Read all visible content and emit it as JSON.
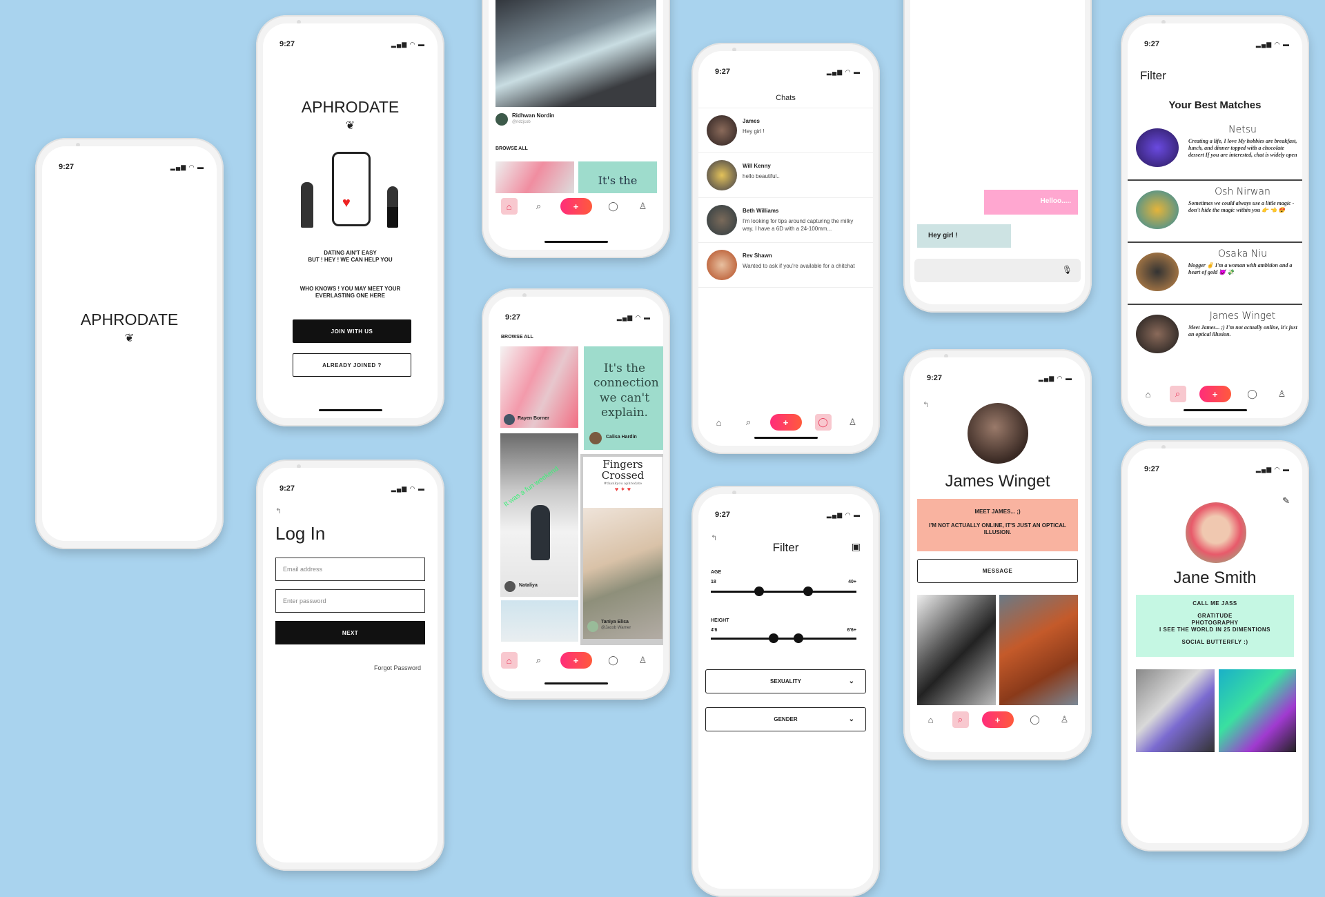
{
  "status": {
    "time": "9:27",
    "icons": "signal-wifi-battery"
  },
  "brand": {
    "name": "APHRODATE",
    "logo": "rose-icon"
  },
  "landing": {
    "line1": "DATING AIN'T EASY",
    "line2": "BUT ! HEY ! WE CAN HELP YOU",
    "line3": "WHO KNOWS ! YOU MAY MEET YOUR",
    "line4": "EVERLASTING ONE HERE",
    "join": "JOIN WITH US",
    "already": "ALREADY JOINED ?"
  },
  "login": {
    "title": "Log In",
    "email_placeholder": "Email address",
    "password_placeholder": "Enter password",
    "next": "NEXT",
    "forgot": "Forgot Password"
  },
  "feed": {
    "author": "Ridhwan Nordin",
    "handle": "@ridzjcob",
    "browse": "BROWSE ALL",
    "teaser": "It's the"
  },
  "browse": {
    "title": "BROWSE ALL",
    "posts": [
      {
        "author": "Rayen Borner"
      },
      {
        "quote": "It's the connection we can't explain.",
        "author": "Calisa Hardin"
      },
      {
        "overlay": "It was a fun weekend",
        "author": "Nataliya"
      },
      {
        "title": "Fingers Crossed",
        "tag": "#thankyou aphrodate",
        "author": "Taniya Elisa",
        "handle": "@Jacob Warner"
      }
    ]
  },
  "chats": {
    "title": "Chats",
    "items": [
      {
        "name": "James",
        "msg": "Hey girl !"
      },
      {
        "name": "Will Kenny",
        "msg": "hello beautiful.."
      },
      {
        "name": "Beth Williams",
        "msg": "I'm looking for tips around capturing the milky way. I have a 6D with a 24-100mm..."
      },
      {
        "name": "Rev Shawn",
        "msg": "Wanted to ask if you're available for a chitchat"
      }
    ]
  },
  "messages": {
    "sent": "Helloo.....",
    "received": "Hey girl !",
    "input_placeholder": ""
  },
  "filter": {
    "title": "Filter",
    "age_label": "AGE",
    "age_min": "18",
    "age_max": "40+",
    "age_range": [
      0.33,
      0.67
    ],
    "height_label": "HEIGHT",
    "height_min": "4'6",
    "height_max": "6'6+",
    "height_range": [
      0.43,
      0.6
    ],
    "sexuality": "SEXUALITY",
    "gender": "GENDER"
  },
  "profile_james": {
    "name": "James Winget",
    "bio1": "MEET JAMES...     ;)",
    "bio2": "I'M NOT ACTUALLY ONLINE, IT'S JUST AN OPTICAL ILLUSION.",
    "message": "MESSAGE"
  },
  "matches": {
    "filter": "Filter",
    "title": "Your Best Matches",
    "items": [
      {
        "name": "Netsu",
        "bio": "Creating a life, I love My hobbies are breakfast, lunch, and dinner topped with a chocolate dessert If you are interested, chat is widely open"
      },
      {
        "name": "Osh Nirwan",
        "bio": "Sometimes we could always use a little magic - don't hide the magic within you 👉 👈 😍"
      },
      {
        "name": "Osaka Niu",
        "bio": "blogger ✌ I'm a woman with ambition and a heart of gold 😈 💸"
      },
      {
        "name": "James Winget",
        "bio": "Meet James...   ;) I'm not actually online, it's just an optical illusion."
      }
    ]
  },
  "profile_jane": {
    "name": "Jane Smith",
    "l1": "CALL ME JASS",
    "l2": "GRATITUDE",
    "l3": "PHOTOGRAPHY",
    "l4": "I SEE THE WORLD IN 25 DIMENTIONS",
    "l5": "SOCIAL BUTTERFLY :)"
  },
  "colors": {
    "background": "#a9d3ee",
    "accent": "#ff2d7a",
    "mint": "#c5f7e3",
    "salmon": "#f9b3a0",
    "pink": "#ffa7d0"
  }
}
